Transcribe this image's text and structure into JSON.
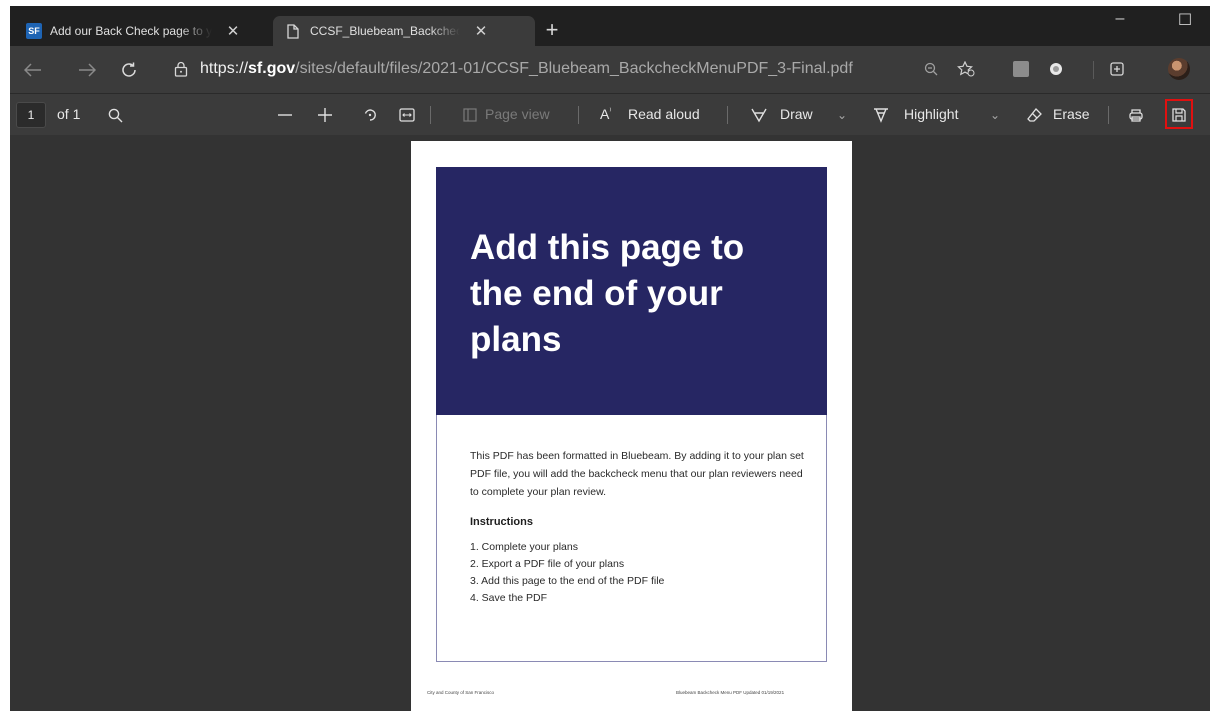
{
  "tabs": [
    {
      "title": "Add our Back Check page to your",
      "favicon": "SF",
      "close": "✕"
    },
    {
      "title": "CCSF_Bluebeam_BackcheckMenuPDF",
      "close": "✕"
    }
  ],
  "new_tab": "+",
  "window_controls": {
    "minimize": "–",
    "maximize": "☐"
  },
  "address": {
    "proto": "https://",
    "host": "sf.gov",
    "path": "/sites/default/files/2021-01/CCSF_Bluebeam_BackcheckMenuPDF_3-Final.pdf"
  },
  "pdf_toolbar": {
    "page_number": "1",
    "page_count": "of 1",
    "page_view": "Page view",
    "read_aloud": "Read aloud",
    "draw": "Draw",
    "highlight": "Highlight",
    "erase": "Erase"
  },
  "document": {
    "title": "Add this page to the end of your plans",
    "intro": "This PDF has been formatted in Bluebeam. By adding it to your plan set PDF file, you will add the backcheck menu that our plan reviewers need to complete your plan review.",
    "instructions_heading": "Instructions",
    "steps": [
      "1.  Complete your plans",
      "2.  Export a PDF file of your plans",
      "3.  Add this page to the end of the PDF file",
      "4.  Save the PDF"
    ],
    "footer_left": "City and County of San Francisco",
    "footer_right": "Bluebeam Backcheck Menu PDF    Updated 01/19/2021"
  },
  "colors": {
    "hero": "#262663",
    "save_highlight": "#e01010",
    "sf_favicon": "#1e64b4"
  }
}
